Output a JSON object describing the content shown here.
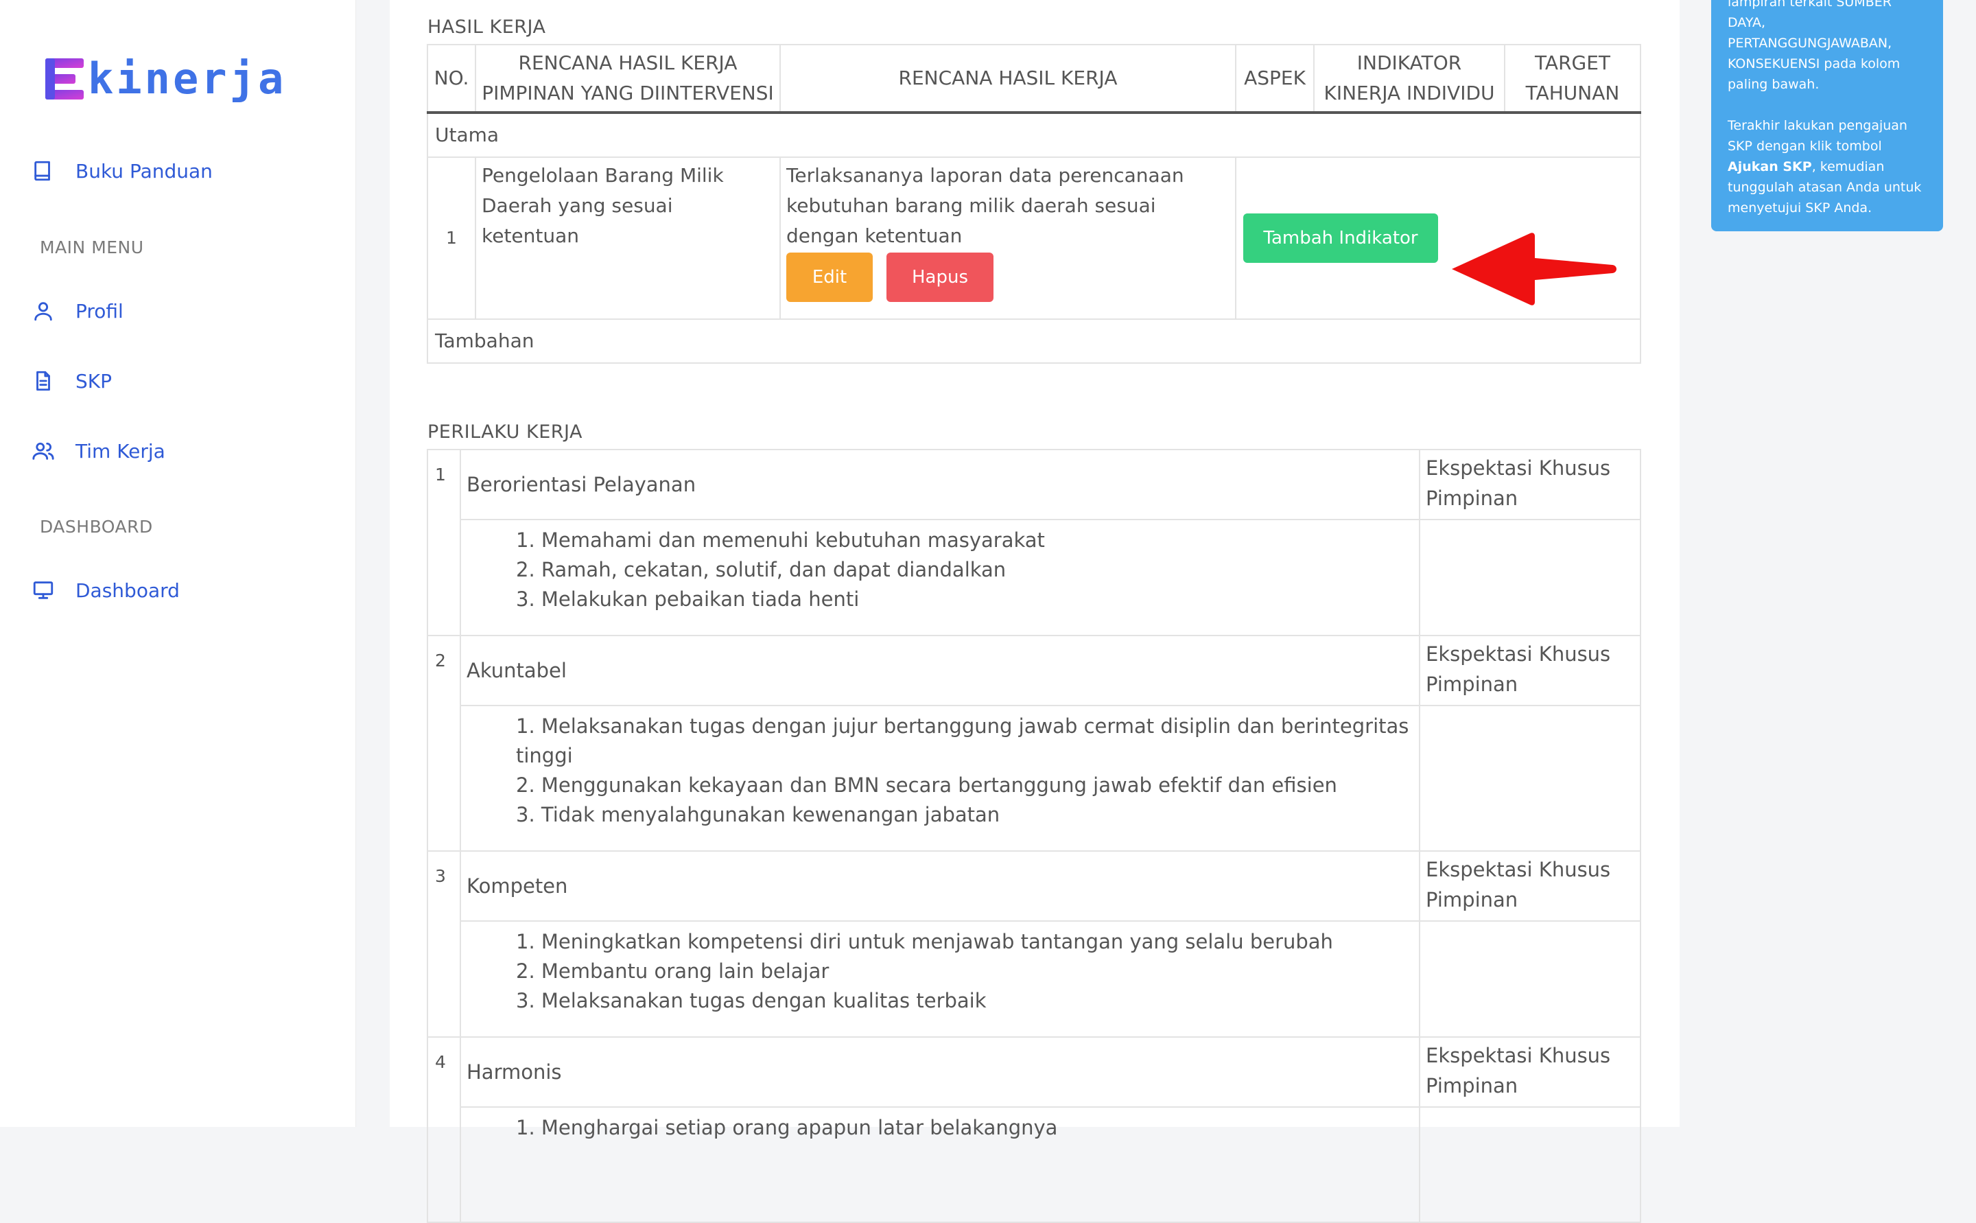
{
  "sidebar": {
    "logo": "kinerja",
    "items": [
      {
        "label": "Buku Panduan"
      },
      {
        "label": "Profil"
      },
      {
        "label": "SKP"
      },
      {
        "label": "Tim Kerja"
      },
      {
        "label": "Dashboard"
      }
    ],
    "sections": {
      "main_menu": "MAIN MENU",
      "dashboard": "DASHBOARD"
    }
  },
  "hasil_kerja": {
    "title": "HASIL KERJA",
    "headers": {
      "no": "NO.",
      "rencana_pimpinan": "RENCANA HASIL KERJA PIMPINAN YANG DIINTERVENSI",
      "rencana": "RENCANA HASIL KERJA",
      "aspek": "ASPEK",
      "indikator": "INDIKATOR KINERJA INDIVIDU",
      "target": "TARGET TAHUNAN"
    },
    "utama_label": "Utama",
    "rows": [
      {
        "no": "1",
        "rencana_pimpinan": "Pengelolaan Barang Milik Daerah yang sesuai ketentuan",
        "rencana": "Terlaksananya laporan data perencanaan kebutuhan barang milik daerah sesuai dengan ketentuan",
        "edit_label": "Edit",
        "hapus_label": "Hapus",
        "tambah_label": "Tambah Indikator"
      }
    ],
    "tambahan_label": "Tambahan"
  },
  "perilaku_kerja": {
    "title": "PERILAKU KERJA",
    "items": [
      {
        "no": "1",
        "title": "Berorientasi Pelayanan",
        "ekspektasi": "Ekspektasi Khusus Pimpinan",
        "points": [
          "1. Memahami dan memenuhi kebutuhan masyarakat",
          "2. Ramah, cekatan, solutif, dan dapat diandalkan",
          "3. Melakukan pebaikan tiada henti"
        ]
      },
      {
        "no": "2",
        "title": "Akuntabel",
        "ekspektasi": "Ekspektasi Khusus Pimpinan",
        "points": [
          "1. Melaksanakan tugas dengan jujur bertanggung jawab cermat disiplin dan berintegritas tinggi",
          "2. Menggunakan kekayaan dan BMN secara bertanggung jawab efektif dan efisien",
          "3. Tidak menyalahgunakan kewenangan jabatan"
        ]
      },
      {
        "no": "3",
        "title": "Kompeten",
        "ekspektasi": "Ekspektasi Khusus Pimpinan",
        "points": [
          "1. Meningkatkan kompetensi diri untuk menjawab tantangan yang selalu berubah",
          "2. Membantu orang lain belajar",
          "3. Melaksanakan tugas dengan kualitas terbaik"
        ]
      },
      {
        "no": "4",
        "title": "Harmonis",
        "ekspektasi": "Ekspektasi Khusus Pimpinan",
        "points": [
          "1. Menghargai setiap orang apapun latar belakangnya"
        ]
      }
    ]
  },
  "info_box": {
    "p1": "lampiran terkait SUMBER DAYA, PERTANGGUNGJAWABAN, KONSEKUENSI pada kolom paling bawah.",
    "p2_prefix": "Terakhir lakukan pengajuan SKP dengan klik tombol ",
    "p2_bold": "Ajukan SKP",
    "p2_suffix": ", kemudian tunggulah atasan Anda untuk menyetujui SKP Anda."
  },
  "colors": {
    "accent": "#2f5ad6",
    "success": "#35d07f",
    "warning": "#f7a430",
    "danger": "#f0555b",
    "info": "#4aa8ec",
    "arrow": "#ee1111"
  }
}
